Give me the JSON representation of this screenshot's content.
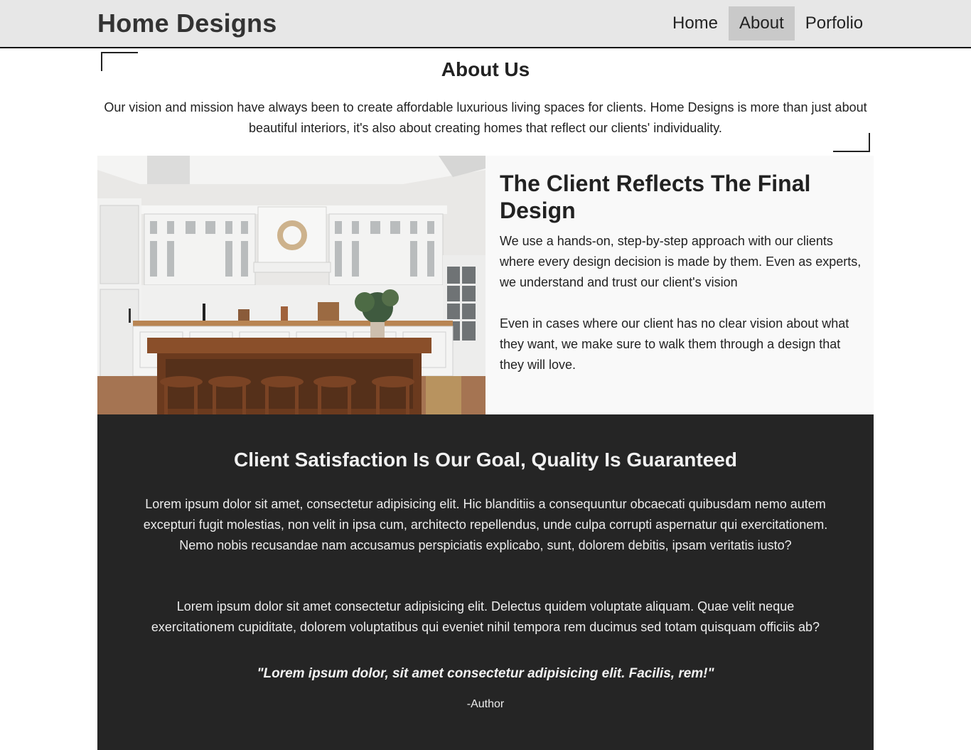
{
  "header": {
    "brand": "Home Designs",
    "nav": [
      {
        "label": "Home"
      },
      {
        "label": "About"
      },
      {
        "label": "Porfolio"
      }
    ]
  },
  "about": {
    "title": "About Us",
    "text": "Our vision and mission have always been to create affordable luxurious living spaces for clients. Home Designs is more than just about beautiful interiors, it's also about creating homes that reflect our clients' individuality."
  },
  "feature": {
    "image_name": "kitchen-photo",
    "title": "The Client Reflects The Final Design",
    "paragraphs": [
      "We use a hands-on, step-by-step approach with our clients where every design decision is made by them. Even as experts, we understand and trust our client's vision",
      "Even in cases where our client has no clear vision about what they want, we make sure to walk them through a design that they will love."
    ]
  },
  "satisfaction": {
    "title": "Client Satisfaction Is Our Goal, Quality Is Guaranteed",
    "paragraphs": [
      "Lorem ipsum dolor sit amet, consectetur adipisicing elit. Hic blanditiis a consequuntur obcaecati quibusdam nemo autem excepturi fugit molestias, non velit in ipsa cum, architecto repellendus, unde culpa corrupti aspernatur qui exercitationem. Nemo nobis recusandae nam accusamus perspiciatis explicabo, sunt, dolorem debitis, ipsam veritatis iusto?",
      "Lorem ipsum dolor sit amet consectetur adipisicing elit. Delectus quidem voluptate aliquam. Quae velit neque exercitationem cupiditate, dolorem voluptatibus qui eveniet nihil tempora rem ducimus sed totam quisquam officiis ab?"
    ],
    "quote": "\"Lorem ipsum dolor, sit amet consectetur adipisicing elit. Facilis, rem!\"",
    "author": "-Author"
  },
  "colors": {
    "header_bg": "#e7e7e7",
    "nav_active_bg": "#c9c9c9",
    "dark_section_bg": "#252525",
    "feature_bg": "#f9f9f9"
  }
}
